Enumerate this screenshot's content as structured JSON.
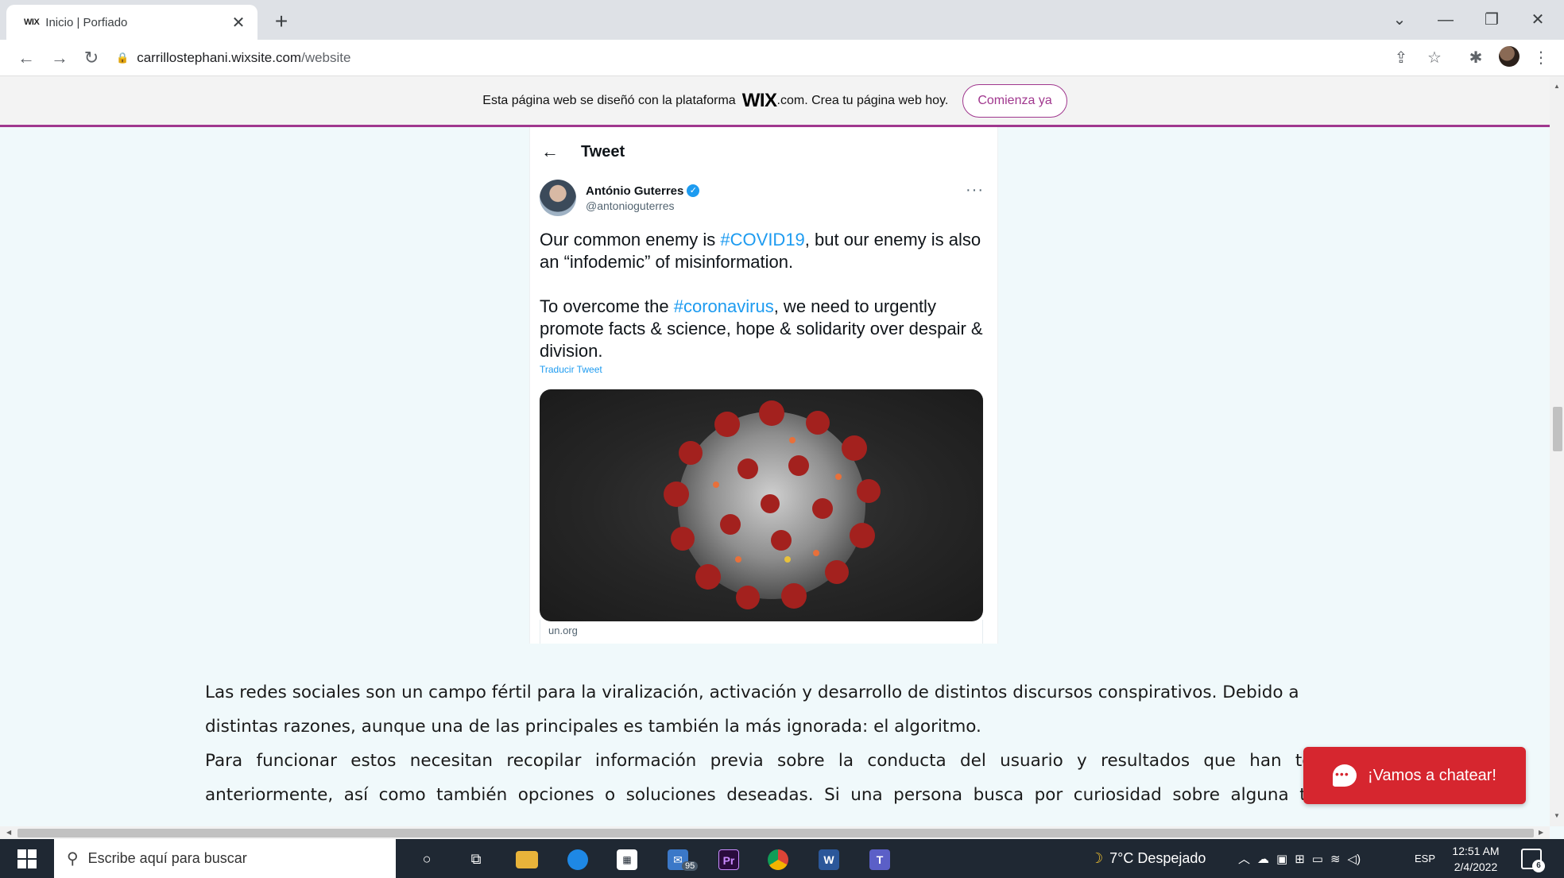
{
  "browser": {
    "tab_title": "Inicio | Porfiado",
    "favicon_text": "WIX",
    "url_host": "carrillostephani.wixsite.com",
    "url_path": "/website"
  },
  "wix_banner": {
    "text_before": "Esta página web se diseñó con la plataforma",
    "logo": "WIX",
    "text_after": ".com. Crea tu página web hoy.",
    "button": "Comienza ya"
  },
  "tweet": {
    "header_title": "Tweet",
    "author_name": "António Guterres",
    "author_handle": "@antonioguterres",
    "p1_before": "Our common enemy is ",
    "p1_hashtag": "#COVID19",
    "p1_after": ", but our enemy is also an “infodemic” of misinformation.",
    "p2_before": "To overcome the ",
    "p2_hashtag": "#coronavirus",
    "p2_after": ", we need to urgently promote facts & science, hope & solidarity over despair & division.",
    "translate": "Traducir Tweet",
    "link_card": "un.org"
  },
  "article": {
    "line1": "Las redes sociales son un campo fértil para la viralización, activación y desarrollo de distintos discursos conspirativos. Debido a",
    "line2": "distintas razones, aunque una de las principales es también la más ignorada: el algoritmo.",
    "line3": "Para funcionar estos necesitan recopilar información previa sobre la conducta del usuario y resultados que han tenido",
    "line4": "anteriormente, así como también opciones o soluciones deseadas. Si una persona busca por curiosidad sobre alguna teoría"
  },
  "chat": {
    "label": "¡Vamos a chatear!"
  },
  "taskbar": {
    "search_placeholder": "Escribe aquí para buscar",
    "mail_badge": "95",
    "weather": "7°C  Despejado",
    "language": "ESP",
    "time": "12:51 AM",
    "date": "2/4/2022",
    "notifications": "6"
  }
}
